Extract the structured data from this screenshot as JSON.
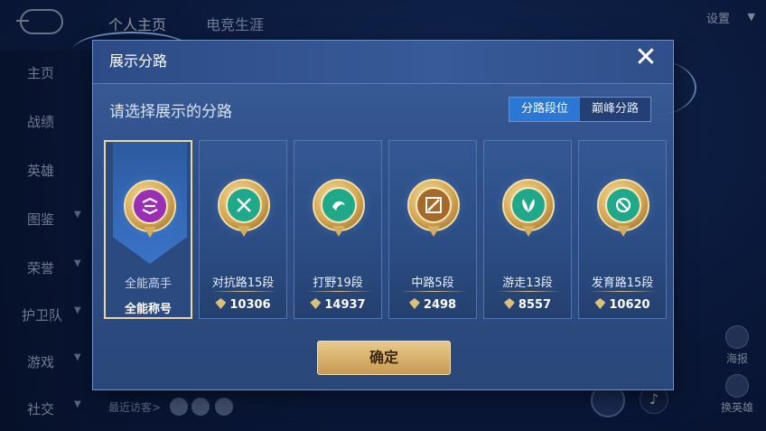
{
  "background": {
    "tabs": [
      "个人主页",
      "电竞生涯"
    ],
    "settings_label": "设置",
    "sidebar": [
      "主页",
      "战绩",
      "英雄",
      "图鉴",
      "荣誉",
      "护卫队",
      "游戏",
      "社交"
    ],
    "right_buttons": [
      "海报",
      "换英雄"
    ],
    "bottom_text": "最近访客>"
  },
  "dialog": {
    "title": "展示分路",
    "subtitle": "请选择展示的分路",
    "toggle": [
      "分路段位",
      "巅峰分路"
    ],
    "confirm_label": "确定",
    "close_icon": "close-icon",
    "cards": [
      {
        "label": "全能高手",
        "value": "全能称号",
        "emblem_color": "#9a2fb5",
        "selected": true
      },
      {
        "label": "对抗路15段",
        "value": "10306",
        "emblem_color": "#1fa98a",
        "selected": false
      },
      {
        "label": "打野19段",
        "value": "14937",
        "emblem_color": "#1fa98a",
        "selected": false
      },
      {
        "label": "中路5段",
        "value": "2498",
        "emblem_color": "#a56a2a",
        "selected": false
      },
      {
        "label": "游走13段",
        "value": "8557",
        "emblem_color": "#1fa98a",
        "selected": false
      },
      {
        "label": "发育路15段",
        "value": "10620",
        "emblem_color": "#1fa98a",
        "selected": false
      }
    ]
  },
  "colors": {
    "accent_blue": "#2b78d4",
    "gold": "#d3a653",
    "panel": "#2f4f88"
  }
}
